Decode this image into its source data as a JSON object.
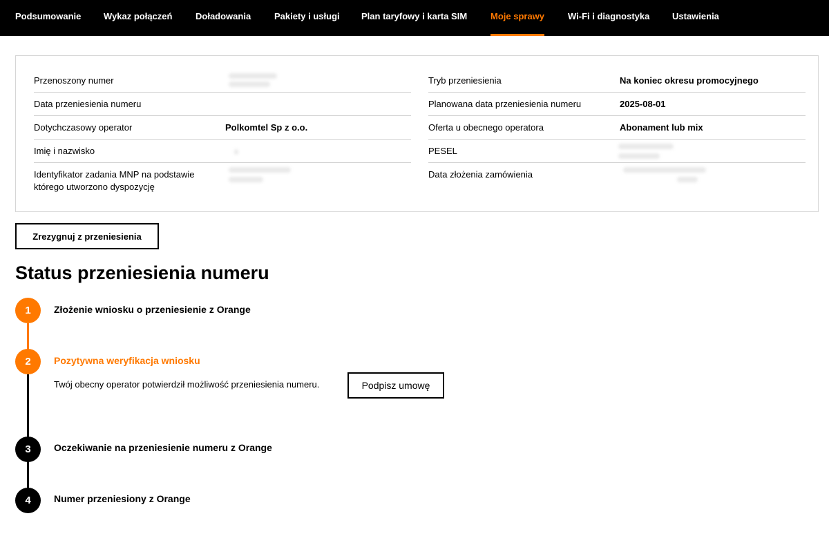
{
  "nav": {
    "items": [
      {
        "label": "Podsumowanie"
      },
      {
        "label": "Wykaz połączeń"
      },
      {
        "label": "Doładowania"
      },
      {
        "label": "Pakiety i usługi"
      },
      {
        "label": "Plan taryfowy i karta SIM"
      },
      {
        "label": "Moje sprawy",
        "active": true
      },
      {
        "label": "Wi-Fi i diagnostyka"
      },
      {
        "label": "Ustawienia"
      }
    ]
  },
  "details": {
    "left": [
      {
        "label": "Przenoszony numer",
        "value": ""
      },
      {
        "label": "Data przeniesienia numeru",
        "value": ""
      },
      {
        "label": "Dotychczasowy operator",
        "value": "Polkomtel Sp z o.o."
      },
      {
        "label": "Imię i nazwisko",
        "value": ""
      },
      {
        "label": "Identyfikator zadania MNP na podstawie którego utworzono dyspozycję",
        "value": ""
      }
    ],
    "right": [
      {
        "label": "Tryb przeniesienia",
        "value": "Na koniec okresu promocyjnego"
      },
      {
        "label": "Planowana data przeniesienia numeru",
        "value": "2025-08-01"
      },
      {
        "label": "Oferta u obecnego operatora",
        "value": "Abonament lub mix"
      },
      {
        "label": "PESEL",
        "value": ""
      },
      {
        "label": "Data złożenia zamówienia",
        "value": ""
      }
    ]
  },
  "resign_button": "Zrezygnuj z przeniesienia",
  "status": {
    "title": "Status przeniesienia numeru",
    "steps": [
      {
        "number": "1",
        "title": "Złożenie wniosku o przeniesienie z Orange",
        "state": "done"
      },
      {
        "number": "2",
        "title": "Pozytywna weryfikacja wniosku",
        "state": "current",
        "description": "Twój obecny operator potwierdził możliwość przeniesienia numeru.",
        "button": "Podpisz umowę"
      },
      {
        "number": "3",
        "title": "Oczekiwanie na przeniesienie numeru z Orange",
        "state": "pending"
      },
      {
        "number": "4",
        "title": "Numer przeniesiony z Orange",
        "state": "pending"
      }
    ]
  },
  "colors": {
    "accent": "#ff7900",
    "nav_bg": "#000000",
    "pending": "#000000"
  }
}
